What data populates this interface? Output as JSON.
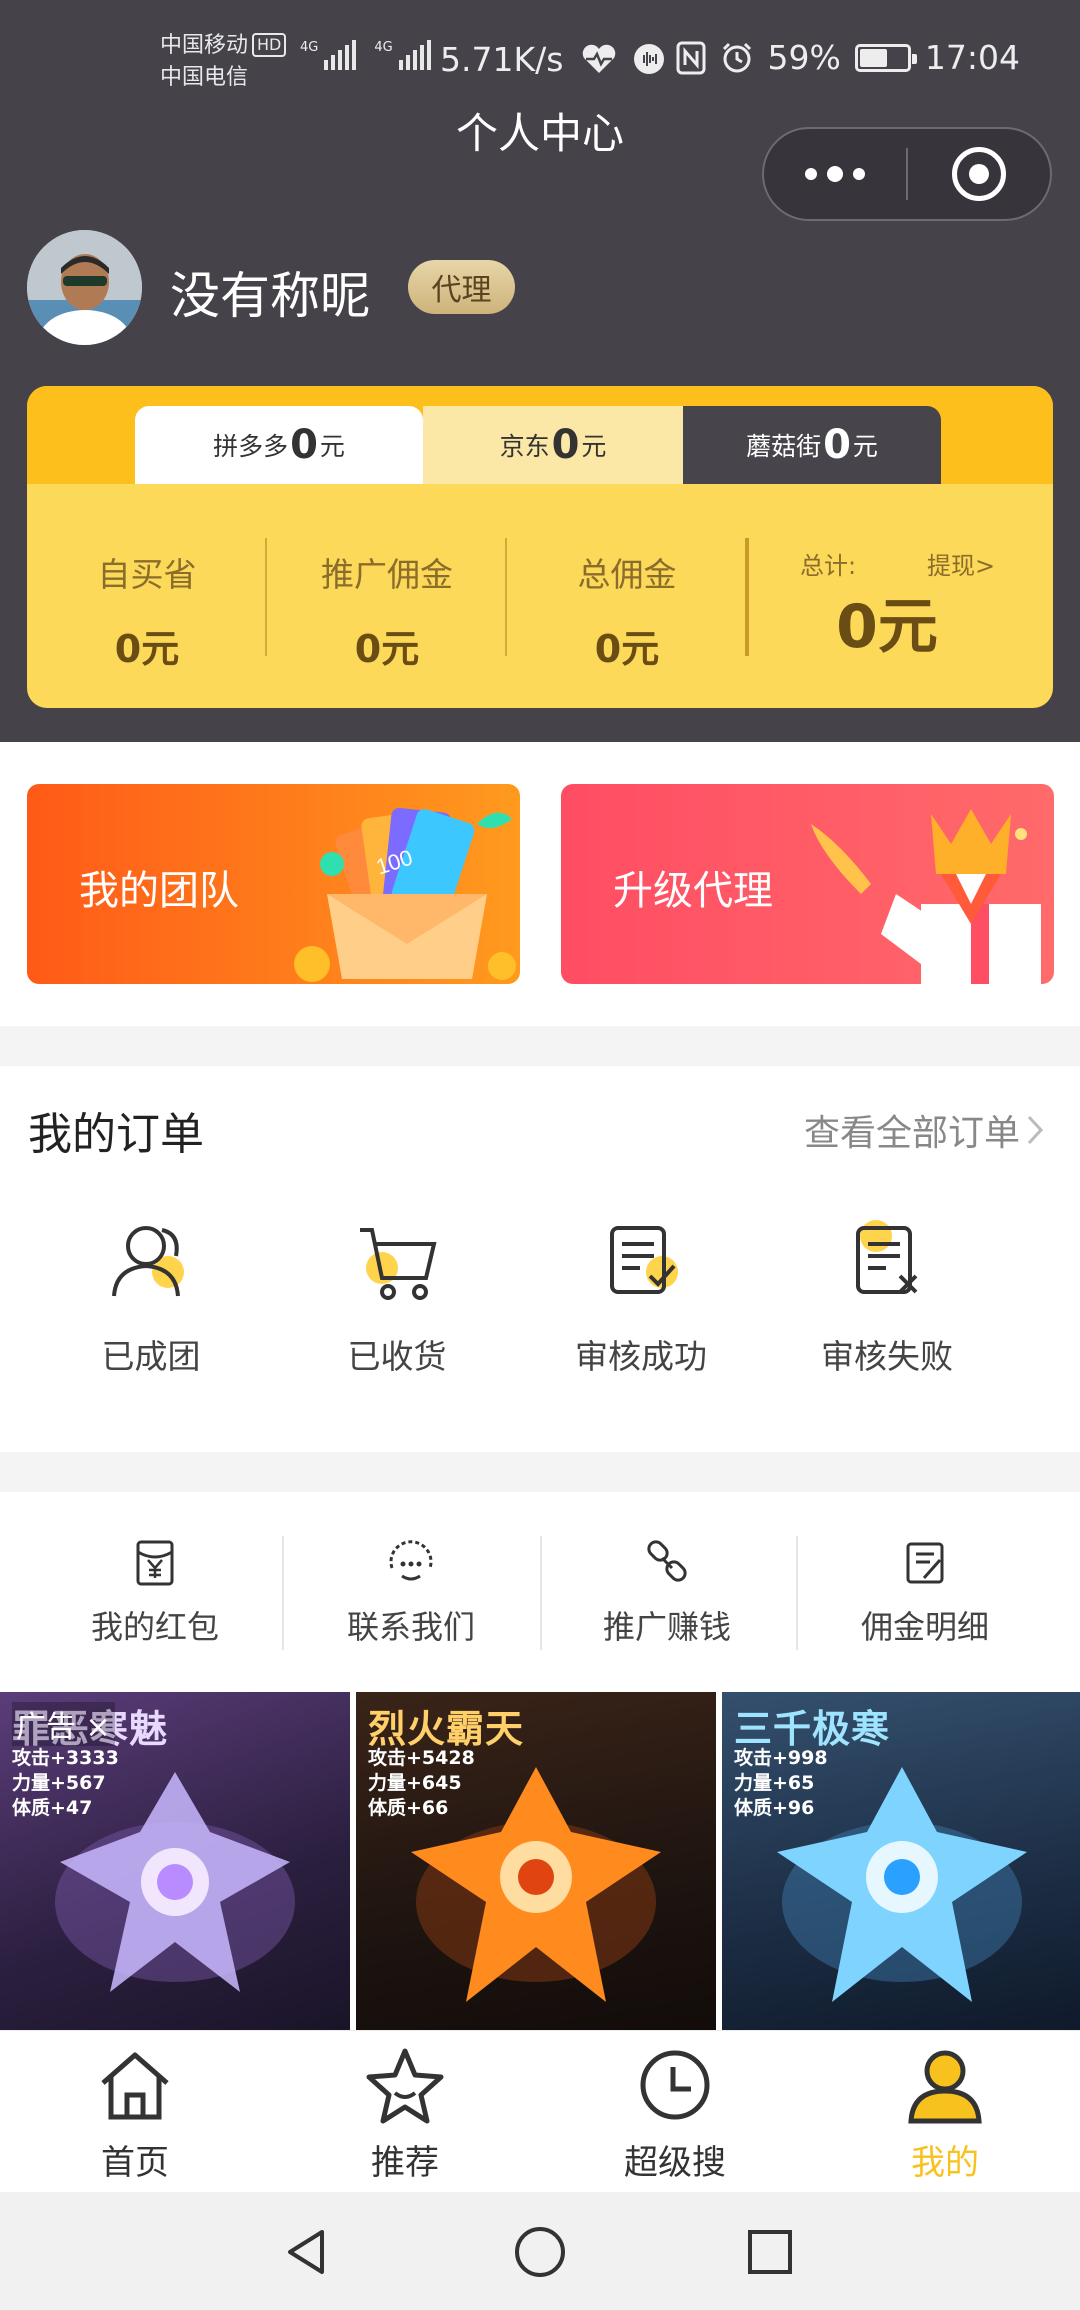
{
  "status_bar": {
    "carrier1": "中国移动",
    "carrier1_badge": "HD",
    "carrier2": "中国电信",
    "signal1_label": "4G",
    "signal2_label": "4G",
    "net_speed": "5.71K/s",
    "battery_percent": "59%",
    "battery_level": 0.59,
    "time": "17:04"
  },
  "header": {
    "title": "个人中心",
    "menu_icon": "more-dots-icon",
    "close_icon": "target-close-icon"
  },
  "profile": {
    "nickname": "没有称昵",
    "badge": "代理"
  },
  "earnings": {
    "tabs": [
      {
        "name": "拼多多",
        "value": "0",
        "unit": "元"
      },
      {
        "name": "京东",
        "value": "0",
        "unit": "元"
      },
      {
        "name": "蘑菇街",
        "value": "0",
        "unit": "元"
      }
    ],
    "stats": [
      {
        "label": "自买省",
        "value": "0元"
      },
      {
        "label": "推广佣金",
        "value": "0元"
      },
      {
        "label": "总佣金",
        "value": "0元"
      }
    ],
    "total_label": "总计:",
    "withdraw_label": "提现>",
    "total_value": "0元"
  },
  "promos": {
    "team_label": "我的团队",
    "upgrade_label": "升级代理",
    "team_card_text": "100"
  },
  "orders": {
    "title": "我的订单",
    "see_all": "查看全部订单",
    "items": [
      {
        "label": "已成团",
        "icon": "group-icon"
      },
      {
        "label": "已收货",
        "icon": "cart-icon"
      },
      {
        "label": "审核成功",
        "icon": "approved-icon"
      },
      {
        "label": "审核失败",
        "icon": "rejected-icon"
      }
    ]
  },
  "quick_links": [
    {
      "label": "我的红包",
      "icon": "red-packet-icon"
    },
    {
      "label": "联系我们",
      "icon": "chat-icon"
    },
    {
      "label": "推广赚钱",
      "icon": "link-icon"
    },
    {
      "label": "佣金明细",
      "icon": "commission-detail-icon"
    }
  ],
  "ads": {
    "tag": "广告",
    "close": "×",
    "items": [
      {
        "title": "罪恶寒魅",
        "stats": [
          "攻击+3333",
          "力量+567",
          "体质+47"
        ]
      },
      {
        "title": "烈火霸天",
        "stats": [
          "攻击+5428",
          "力量+645",
          "体质+66"
        ]
      },
      {
        "title": "三千极寒",
        "stats": [
          "攻击+998",
          "力量+65",
          "体质+96"
        ]
      }
    ]
  },
  "tabbar": {
    "items": [
      {
        "label": "首页",
        "icon": "home-icon"
      },
      {
        "label": "推荐",
        "icon": "star-icon"
      },
      {
        "label": "超级搜",
        "icon": "clock-icon"
      },
      {
        "label": "我的",
        "icon": "user-icon"
      }
    ],
    "active_index": 3,
    "active_color": "#f8c21e"
  },
  "colors": {
    "header_bg": "#45424a",
    "card_yellow": "#fdd95a",
    "accent_orange": "#ff6a1e",
    "accent_red": "#ff4d63"
  }
}
